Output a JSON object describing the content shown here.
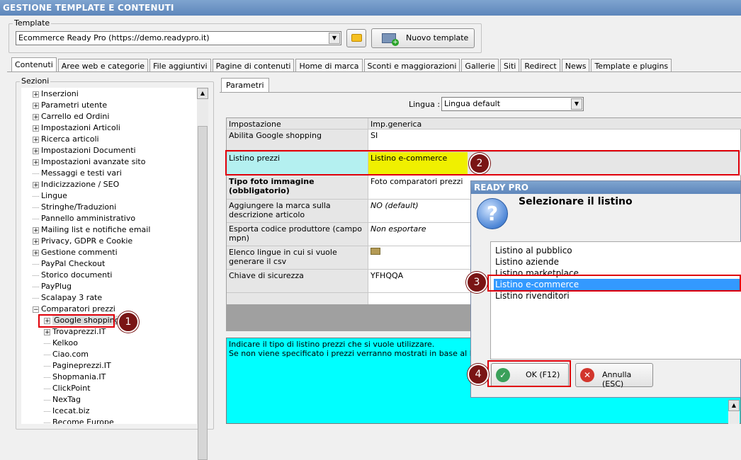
{
  "window": {
    "title": "GESTIONE TEMPLATE E CONTENUTI"
  },
  "template": {
    "group_label": "Template",
    "selected": "Ecommerce Ready Pro (https://demo.readypro.it)",
    "new_button": "Nuovo template"
  },
  "tabs": [
    "Contenuti",
    "Aree web e categorie",
    "File aggiuntivi",
    "Pagine di contenuti",
    "Home di marca",
    "Sconti e maggiorazioni",
    "Gallerie",
    "Siti",
    "Redirect",
    "News",
    "Template e plugins"
  ],
  "sections": {
    "label": "Sezioni",
    "items": [
      {
        "label": "Inserzioni",
        "expandable": true,
        "level": 0
      },
      {
        "label": "Parametri utente",
        "expandable": true,
        "level": 0
      },
      {
        "label": "Carrello ed Ordini",
        "expandable": true,
        "level": 0
      },
      {
        "label": "Impostazioni Articoli",
        "expandable": true,
        "level": 0
      },
      {
        "label": "Ricerca articoli",
        "expandable": true,
        "level": 0
      },
      {
        "label": "Impostazioni Documenti",
        "expandable": true,
        "level": 0
      },
      {
        "label": "Impostazioni avanzate sito",
        "expandable": true,
        "level": 0
      },
      {
        "label": "Messaggi e testi vari",
        "expandable": false,
        "level": 0
      },
      {
        "label": "Indicizzazione / SEO",
        "expandable": true,
        "level": 0
      },
      {
        "label": "Lingue",
        "expandable": false,
        "level": 0
      },
      {
        "label": "Stringhe/Traduzioni",
        "expandable": false,
        "level": 0
      },
      {
        "label": "Pannello amministrativo",
        "expandable": false,
        "level": 0
      },
      {
        "label": "Mailing list e notifiche email",
        "expandable": true,
        "level": 0
      },
      {
        "label": "Privacy, GDPR e Cookie",
        "expandable": true,
        "level": 0
      },
      {
        "label": "Gestione commenti",
        "expandable": true,
        "level": 0
      },
      {
        "label": "PayPal Checkout",
        "expandable": false,
        "level": 0
      },
      {
        "label": "Storico documenti",
        "expandable": false,
        "level": 0
      },
      {
        "label": "PayPlug",
        "expandable": false,
        "level": 0
      },
      {
        "label": "Scalapay 3 rate",
        "expandable": false,
        "level": 0
      },
      {
        "label": "Comparatori prezzi",
        "expandable": true,
        "expanded": true,
        "level": 0
      },
      {
        "label": "Google shopping",
        "expandable": true,
        "level": 1,
        "selected": true
      },
      {
        "label": "Trovaprezzi.IT",
        "expandable": true,
        "level": 1
      },
      {
        "label": "Kelkoo",
        "expandable": false,
        "level": 1
      },
      {
        "label": "Ciao.com",
        "expandable": false,
        "level": 1
      },
      {
        "label": "Pagineprezzi.IT",
        "expandable": false,
        "level": 1
      },
      {
        "label": "Shopmania.IT",
        "expandable": false,
        "level": 1
      },
      {
        "label": "ClickPoint",
        "expandable": false,
        "level": 1
      },
      {
        "label": "NexTag",
        "expandable": false,
        "level": 1
      },
      {
        "label": "Icecat.biz",
        "expandable": false,
        "level": 1
      },
      {
        "label": "Become Europe",
        "expandable": false,
        "level": 1
      }
    ]
  },
  "params": {
    "tab": "Parametri",
    "lingua_label": "Lingua :",
    "lingua_value": "Lingua default",
    "col_setting": "Impostazione",
    "col_value": "Imp.generica",
    "rows": [
      {
        "name": "Abilita Google shopping",
        "value": "SI"
      },
      {
        "name": "Listino prezzi",
        "value": "Listino e-commerce"
      },
      {
        "name": "Tipo foto immagine (obbligatorio)",
        "value": "Foto comparatori prezzi"
      },
      {
        "name": "Aggiungere la marca sulla descrizione articolo",
        "value": "NO (default)"
      },
      {
        "name": "Esporta codice produttore (campo mpn)",
        "value": "Non esportare"
      },
      {
        "name": "Elenco lingue in cui si vuole generare il csv",
        "value": ""
      },
      {
        "name": "Chiave di sicurezza",
        "value": "YFHQQA"
      }
    ],
    "description_line1": "Indicare il tipo di listino prezzi che si vuole utilizzare.",
    "description_line2": "Se non viene specificato i prezzi verranno mostrati in base al listino dell'a"
  },
  "dialog": {
    "title": "READY PRO",
    "heading": "Selezionare il listino",
    "options": [
      "Listino al pubblico",
      "Listino aziende",
      "Listino marketplace",
      "Listino e-commerce",
      "Listino rivenditori"
    ],
    "selected_index": 3,
    "ok_label": "OK (F12)",
    "cancel_label": "Annulla (ESC)"
  },
  "callouts": [
    "1",
    "2",
    "3",
    "4"
  ],
  "colors": {
    "accent_red": "#e0000a",
    "badge": "#7a1515",
    "cyan": "#b4f0f0",
    "yellow": "#f0f000",
    "select_blue": "#3399ff",
    "desc_bg": "#00ffff"
  }
}
